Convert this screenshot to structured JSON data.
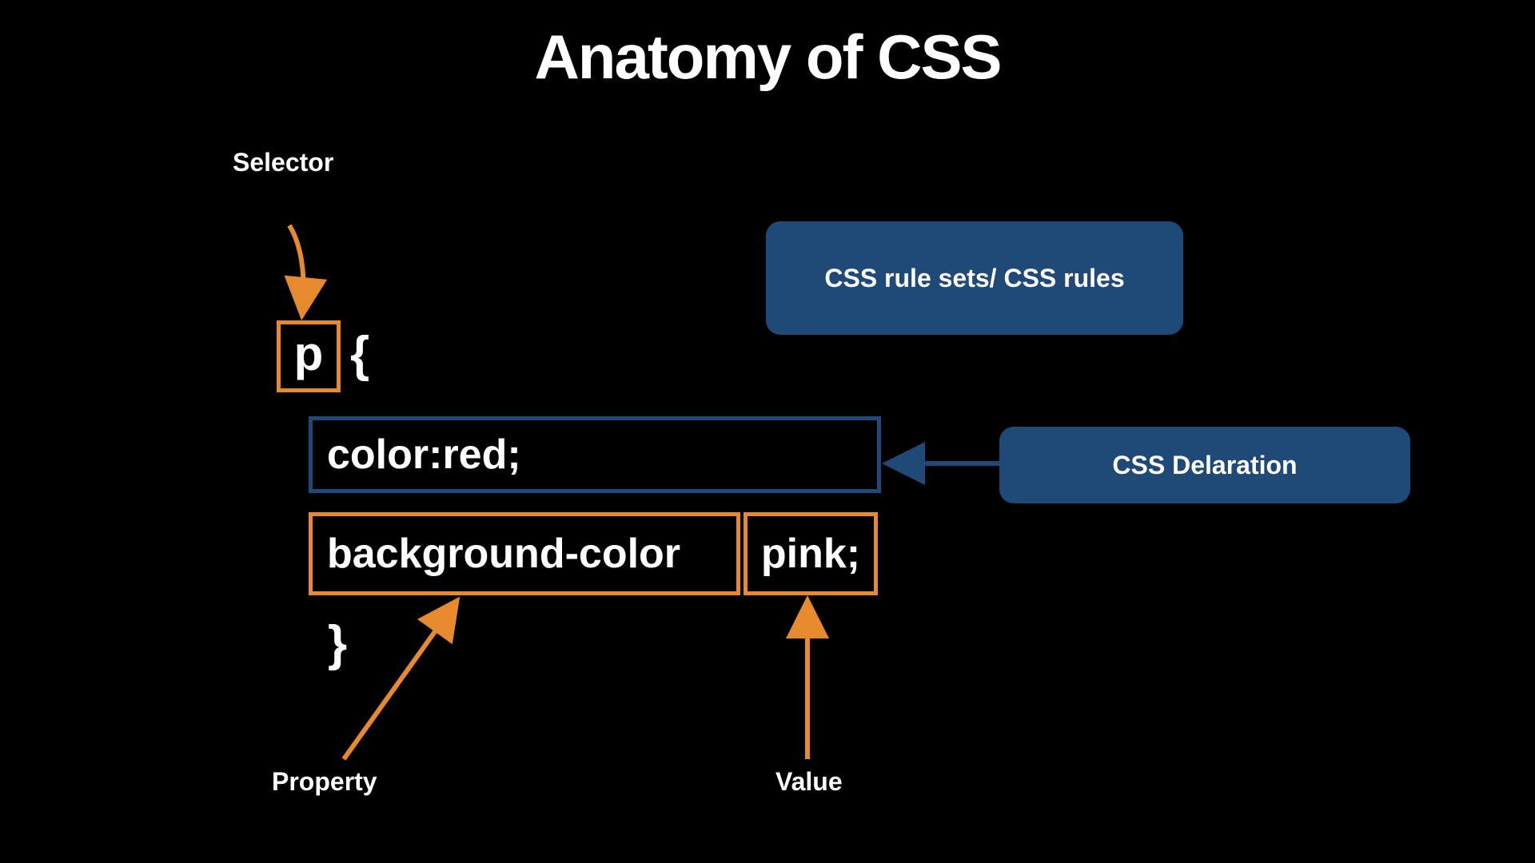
{
  "title": "Anatomy of CSS",
  "labels": {
    "selector": "Selector",
    "property": "Property",
    "value": "Value",
    "ruleset_pill": "CSS rule sets/ CSS rules",
    "declaration_pill": "CSS Delaration"
  },
  "code": {
    "selector_token": "p",
    "brace_open": "{",
    "brace_close": "}",
    "declaration1": "color:red;",
    "property2": "background-color",
    "value2": "pink;"
  },
  "colors": {
    "orange": "#e78a2e",
    "blue_fill": "#1f4a78"
  }
}
